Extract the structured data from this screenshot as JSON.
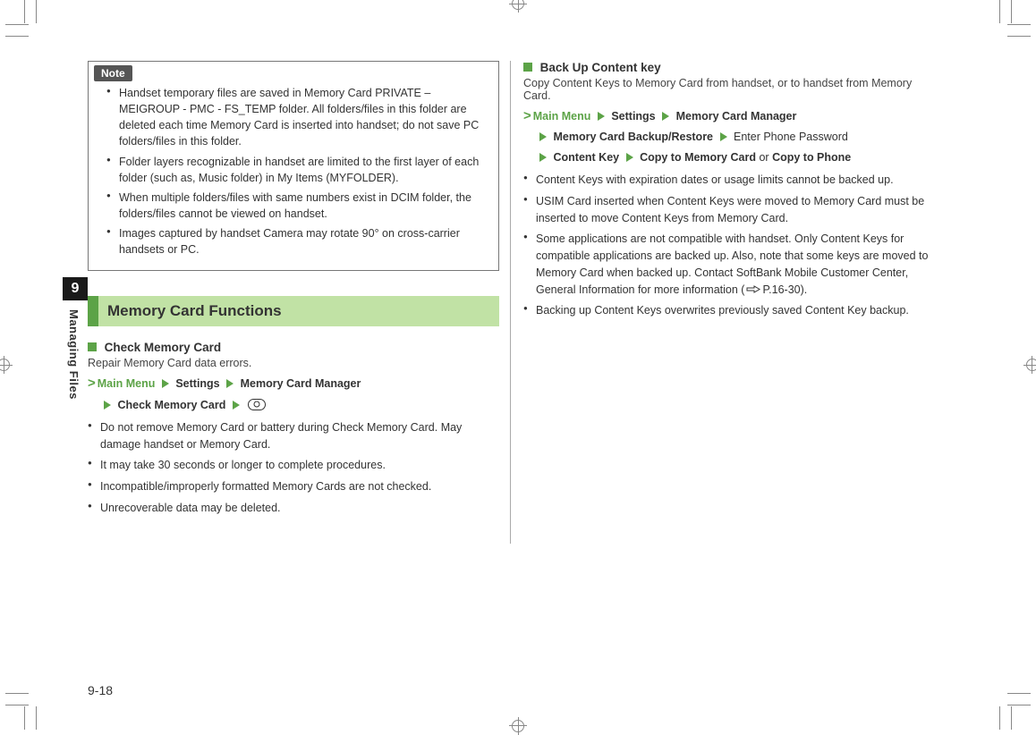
{
  "sidebar": {
    "chapter_number": "9",
    "chapter_title": "Managing Files"
  },
  "note": {
    "label": "Note",
    "items": [
      "Handset temporary files are saved in Memory Card PRIVATE – MEIGROUP - PMC - FS_TEMP folder. All folders/files in this folder are deleted each time Memory Card is inserted into handset; do not save PC folders/files in this folder.",
      "Folder layers recognizable in handset are limited to the first layer of each folder (such as, Music folder) in My Items (MYFOLDER).",
      "When multiple folders/files with same numbers exist in DCIM folder, the folders/files cannot be viewed on handset.",
      "Images captured by handset Camera may rotate 90° on cross-carrier handsets or PC."
    ]
  },
  "section_heading": "Memory Card Functions",
  "check": {
    "title": "Check Memory Card",
    "desc": "Repair Memory Card data errors.",
    "path_main_menu": "Main Menu",
    "path_settings": "Settings",
    "path_mgr": "Memory Card Manager",
    "path_check": "Check Memory Card",
    "bullets": [
      "Do not remove Memory Card or battery during Check Memory Card. May damage handset or Memory Card.",
      "It may take 30 seconds or longer to complete procedures.",
      "Incompatible/improperly formatted Memory Cards are not checked.",
      "Unrecoverable data may be deleted."
    ]
  },
  "backup": {
    "title": "Back Up Content key",
    "desc": "Copy Content Keys to Memory Card from handset, or to handset from Memory Card.",
    "path_main_menu": "Main Menu",
    "path_settings": "Settings",
    "path_mgr": "Memory Card Manager",
    "path_br": "Memory Card Backup/Restore",
    "path_pw": "Enter Phone Password",
    "path_ck": "Content Key",
    "path_copy_mc": "Copy to Memory Card",
    "or": "or",
    "path_copy_phone": "Copy to Phone",
    "bullets_0": "Content Keys with expiration dates or usage limits cannot be backed up.",
    "bullets_1": "USIM Card inserted when Content Keys were moved to Memory Card must be inserted to move Content Keys from Memory Card.",
    "bullets_2a": "Some applications are not compatible with handset. Only Content Keys for compatible applications are backed up. Also, note that some keys are moved to Memory Card when backed up. Contact SoftBank Mobile Customer Center, General Information for more information (",
    "bullets_2_ref": "P.16-30).",
    "bullets_3": "Backing up Content Keys overwrites previously saved Content Key backup."
  },
  "page_number": "9-18"
}
